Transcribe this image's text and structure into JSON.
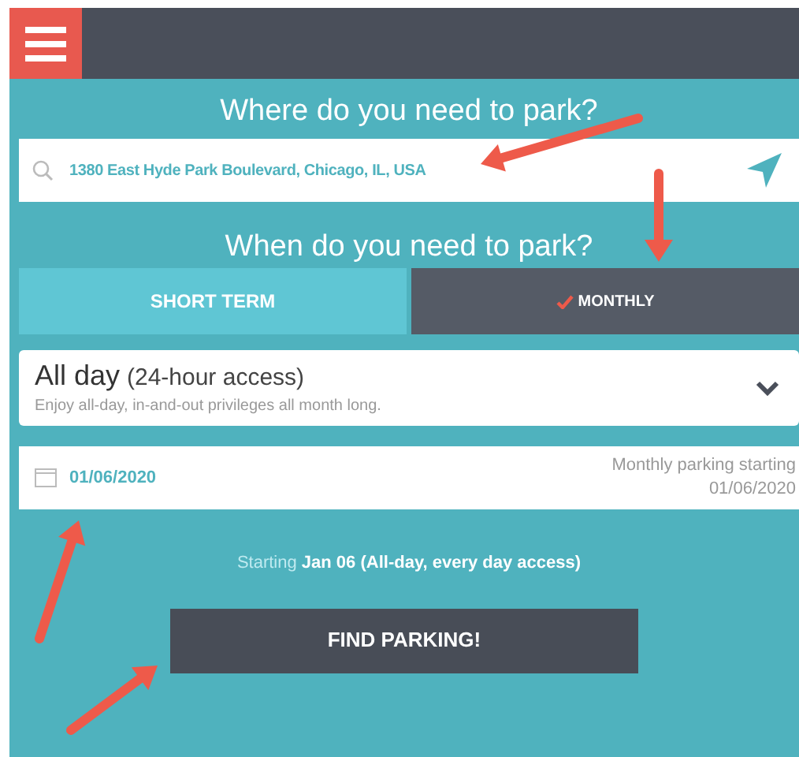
{
  "location": {
    "heading": "Where do you need to park?",
    "value": "1380 East Hyde Park Boulevard, Chicago, IL, USA"
  },
  "time": {
    "heading": "When do you need to park?"
  },
  "tabs": [
    {
      "label": "SHORT TERM",
      "selected": false
    },
    {
      "label": "MONTHLY",
      "selected": true
    }
  ],
  "plan": {
    "title": "All day",
    "detail": "(24-hour access)",
    "description": "Enjoy all-day, in-and-out privileges all month long."
  },
  "date": {
    "value": "01/06/2020",
    "note": "Monthly parking starting",
    "note_date": "01/06/2020"
  },
  "summary": "Starting **Jan 06 (All-day, every day access)**",
  "button": "FIND PARKING!"
}
